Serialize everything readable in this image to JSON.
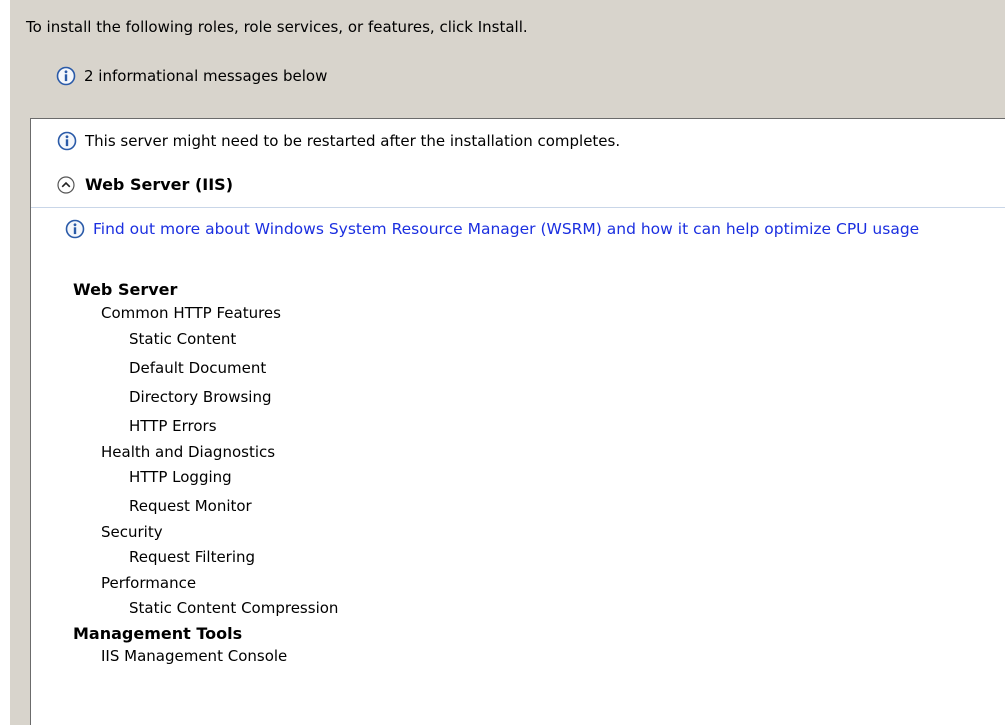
{
  "intro": {
    "text": "To install the following roles, role services, or features, click Install."
  },
  "message_count": {
    "icon": "info-icon",
    "text": "2 informational messages below"
  },
  "panel": {
    "restart_note": {
      "icon": "info-icon",
      "text": "This server might need to be restarted after the installation completes."
    },
    "section": {
      "icon": "collapse-chevron-icon",
      "title": "Web Server (IIS)"
    },
    "wsrm_link": {
      "icon": "info-icon",
      "text": "Find out more about Windows System Resource Manager (WSRM) and how it can help optimize CPU usage"
    },
    "tree": {
      "web_server": "Web Server",
      "common_http": "Common HTTP Features",
      "static_content": "Static Content",
      "default_document": "Default Document",
      "directory_browsing": "Directory Browsing",
      "http_errors": "HTTP Errors",
      "health_diagnostics": "Health and Diagnostics",
      "http_logging": "HTTP Logging",
      "request_monitor": "Request Monitor",
      "security": "Security",
      "request_filtering": "Request Filtering",
      "performance": "Performance",
      "static_compression": "Static Content Compression",
      "management_tools": "Management Tools",
      "iis_console": "IIS Management Console"
    }
  },
  "colors": {
    "window_bg": "#d8d4cc",
    "panel_bg": "#ffffff",
    "link": "#1b2fe0",
    "info_icon": "#2a5aa8"
  }
}
